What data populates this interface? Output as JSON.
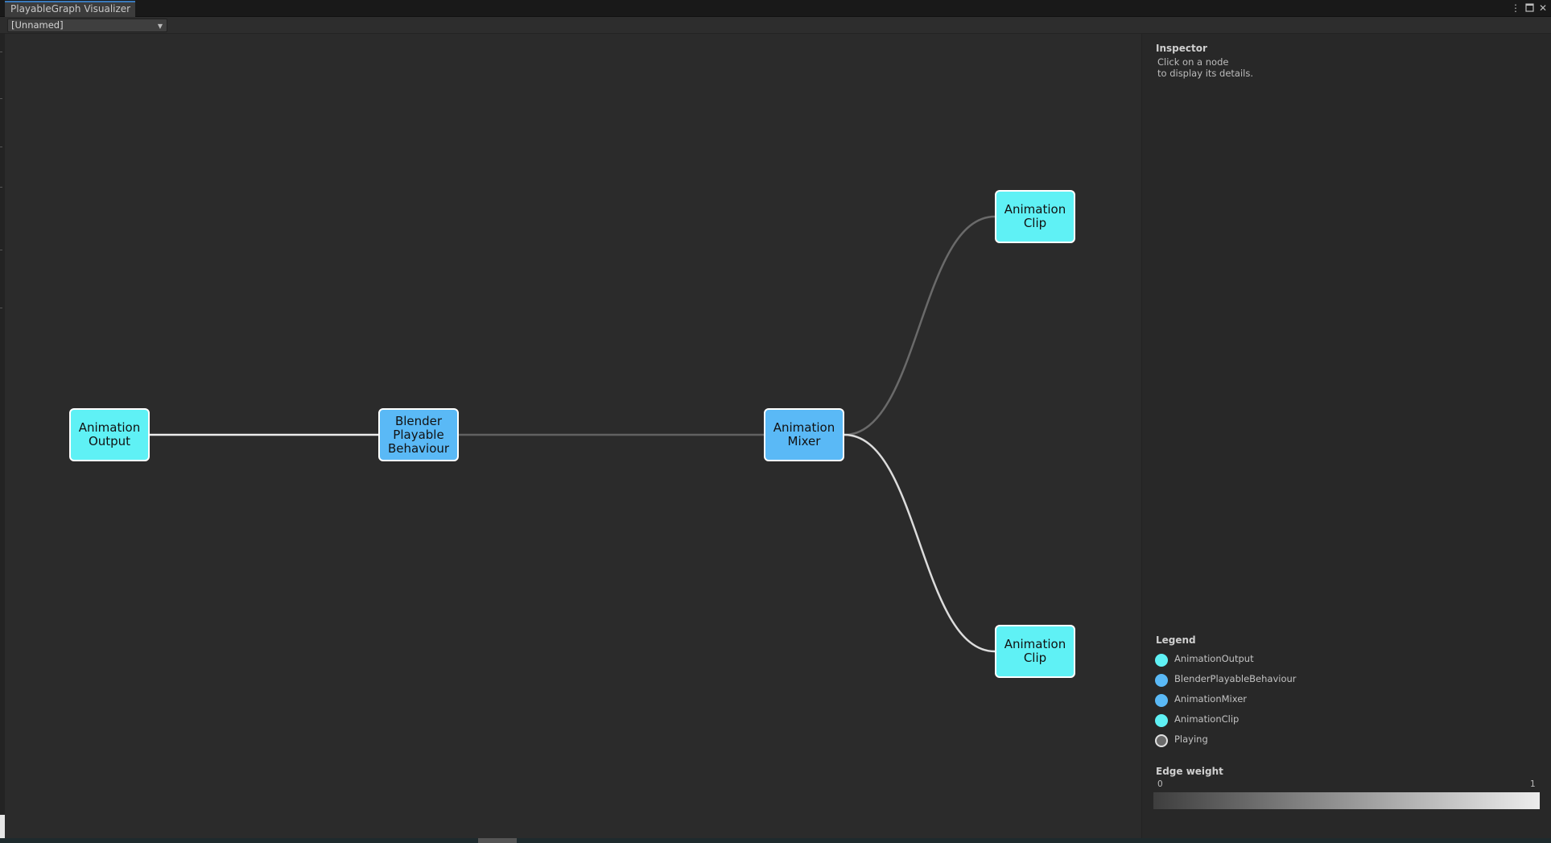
{
  "window": {
    "tab_title": "PlayableGraph Visualizer",
    "controls": {
      "more": "⋮",
      "maximize": "🗖",
      "close": "✕"
    }
  },
  "toolbar": {
    "graph_select": {
      "value": "[Unnamed]",
      "icon": "chevron-down-icon"
    }
  },
  "graph": {
    "nodes": [
      {
        "id": "output",
        "label": "Animation\nOutput",
        "type": "AnimationOutput"
      },
      {
        "id": "blender",
        "label": "Blender\nPlayable\nBehaviour",
        "type": "BlenderPlayableBehaviour"
      },
      {
        "id": "mixer",
        "label": "Animation\nMixer",
        "type": "AnimationMixer"
      },
      {
        "id": "clip1",
        "label": "Animation\nClip",
        "type": "AnimationClip"
      },
      {
        "id": "clip2",
        "label": "Animation\nClip",
        "type": "AnimationClip"
      }
    ],
    "edges": [
      {
        "from": "blender",
        "to": "output",
        "weight": 1.0
      },
      {
        "from": "mixer",
        "to": "blender",
        "weight": 0.2
      },
      {
        "from": "clip1",
        "to": "mixer",
        "weight": 0.25
      },
      {
        "from": "clip2",
        "to": "mixer",
        "weight": 0.9
      }
    ]
  },
  "colors": {
    "AnimationOutput": "#5ff1f5",
    "BlenderPlayableBehaviour": "#5ab9f6",
    "AnimationMixer": "#5ab9f6",
    "AnimationClip": "#5ff1f5",
    "Playing": "#6b6b6b",
    "node_border": "#ffffff"
  },
  "inspector": {
    "title": "Inspector",
    "hint": "Click on a node\nto display its details."
  },
  "legend": {
    "title": "Legend",
    "items": [
      {
        "label": "AnimationOutput",
        "color": "#5ff1f5"
      },
      {
        "label": "BlenderPlayableBehaviour",
        "color": "#5ab9f6"
      },
      {
        "label": "AnimationMixer",
        "color": "#5ab9f6"
      },
      {
        "label": "AnimationClip",
        "color": "#5ff1f5"
      },
      {
        "label": "Playing",
        "color": "#6b6b6b"
      }
    ]
  },
  "edge_weight": {
    "title": "Edge weight",
    "min": "0",
    "max": "1"
  }
}
